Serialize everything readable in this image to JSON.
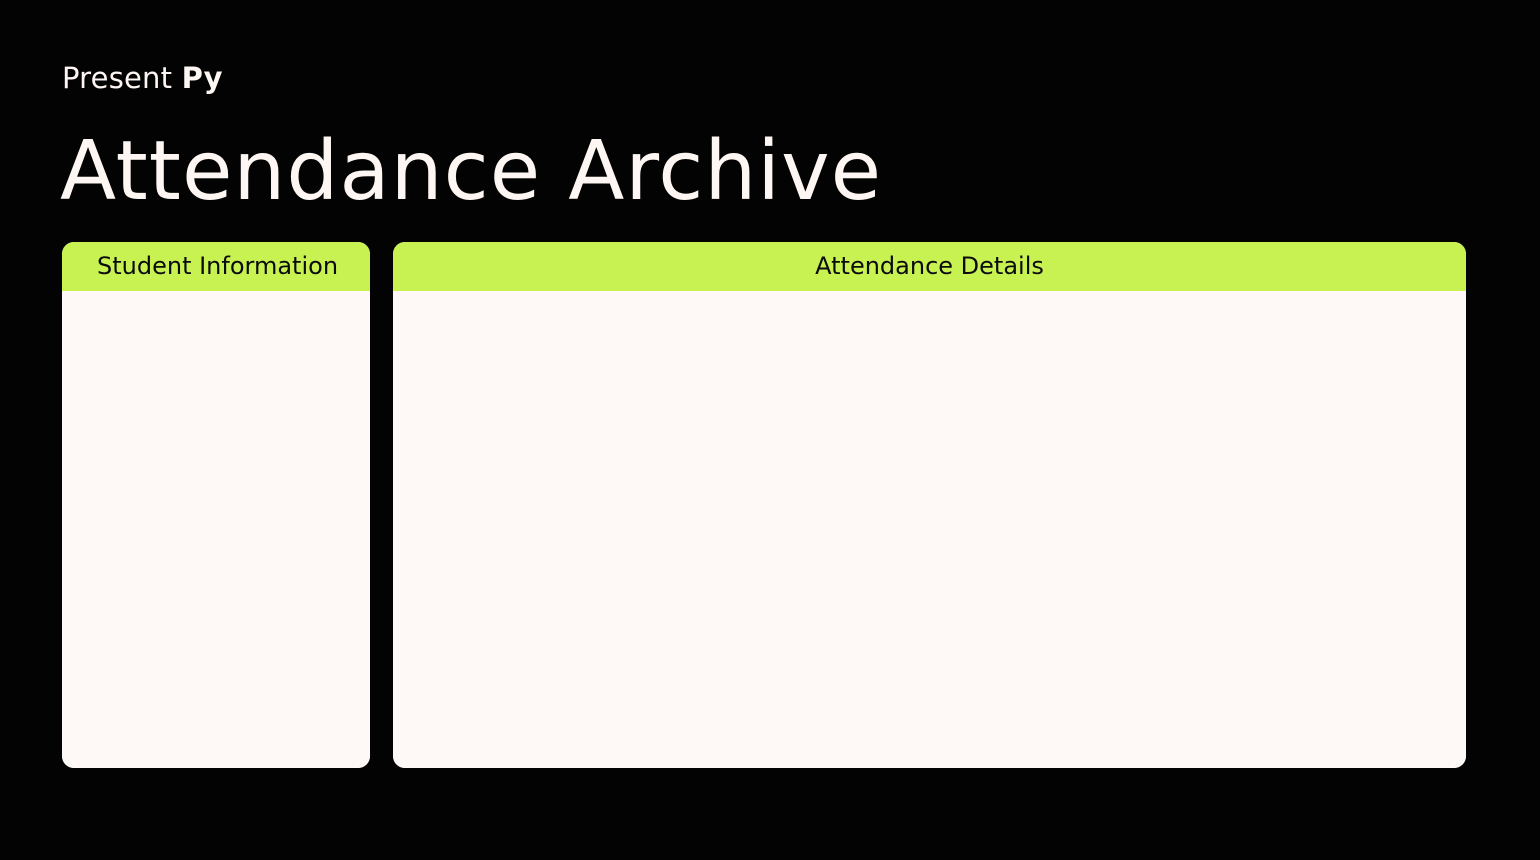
{
  "app": {
    "brand_light": "Present ",
    "brand_bold": "Py",
    "page_title": "Attendance Archive"
  },
  "panels": {
    "student_information": {
      "header": "Student Information"
    },
    "attendance_details": {
      "header": "Attendance Details"
    }
  },
  "colors": {
    "background": "#030303",
    "accent": "#c8f251",
    "panel": "#fef9f7",
    "text_light": "#fdf6f3"
  }
}
